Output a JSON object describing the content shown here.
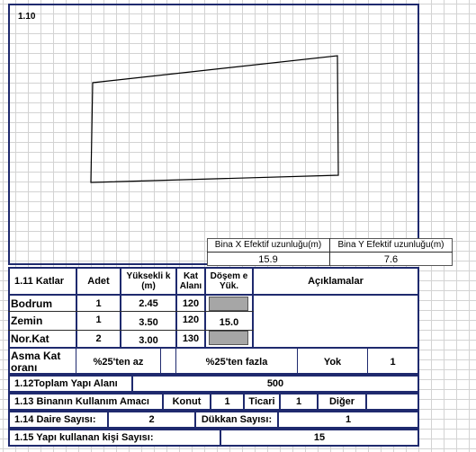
{
  "section_label": "1.10",
  "dims": {
    "x_label": "Bina X Efektif uzunluğu(m)",
    "y_label": "Bina Y Efektif uzunluğu(m)",
    "x_value": "15.9",
    "y_value": "7.6"
  },
  "table": {
    "title": "1.11 Katlar",
    "headers": {
      "adet": "Adet",
      "yukseklik": "Yüksekli k (m)",
      "kat_alani": "Kat Alanı",
      "doseme": "Döşem e Yük.",
      "aciklamalar": "Açıklamalar"
    },
    "rows": [
      {
        "name": "Bodrum",
        "adet": "1",
        "yukseklik": "2.45",
        "alan": "120",
        "doseme": ""
      },
      {
        "name": "Zemin",
        "adet": "1",
        "yukseklik": "3.50",
        "alan": "120",
        "doseme": "15.0"
      },
      {
        "name": "Nor.Kat",
        "adet": "2",
        "yukseklik": "3.00",
        "alan": "130",
        "doseme": ""
      }
    ],
    "asma_kat": {
      "label": "Asma Kat oranı",
      "az": "%25'ten az",
      "fazla": "%25'ten fazla",
      "yok": "Yok",
      "yok_value": "1"
    }
  },
  "toplam": {
    "label": "1.12Toplam Yapı Alanı",
    "value": "500"
  },
  "kullanim": {
    "label": "1.13 Binanın Kullanım Amacı",
    "konut": "Konut",
    "konut_value": "1",
    "ticari": "Ticari",
    "ticari_value": "1",
    "diger": "Diğer"
  },
  "daire": {
    "label": "1.14 Daire Sayısı:",
    "value": "2",
    "dukkan_label": "Dükkan Sayısı:",
    "dukkan_value": "1"
  },
  "kisi": {
    "label": "1.15 Yapı kullanan kişi Sayısı:",
    "value": "15"
  }
}
